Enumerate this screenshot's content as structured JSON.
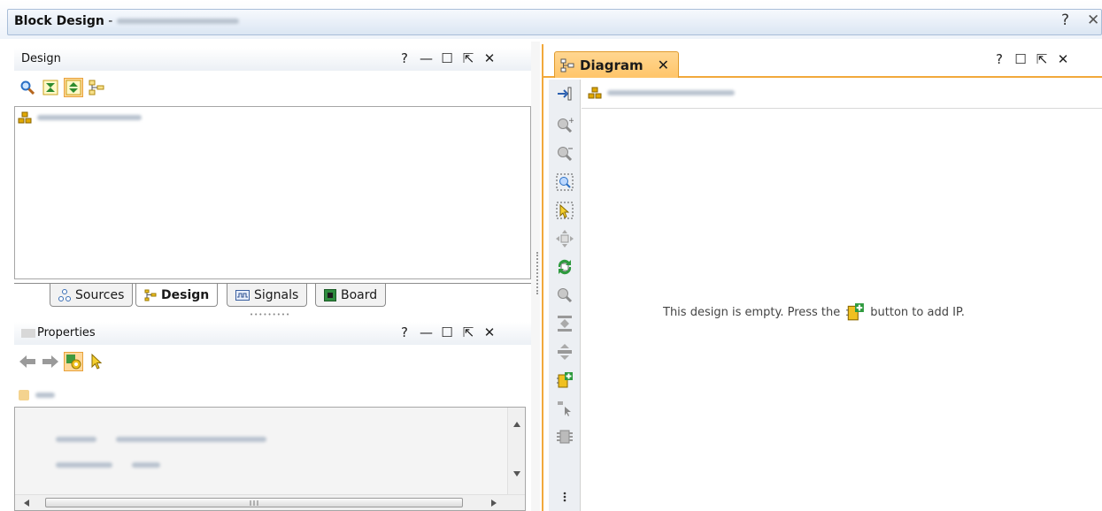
{
  "window": {
    "title": "Block Design",
    "title_separator": " - ",
    "help": "?",
    "close": "✕"
  },
  "design_pane": {
    "title": "Design",
    "buttons": {
      "help": "?",
      "minimize": "—",
      "maximize": "☐",
      "float": "⇱",
      "close": "✕"
    },
    "toolbar": [
      "search-icon",
      "collapse-all-icon",
      "expand-all-icon",
      "hierarchy-icon"
    ],
    "tree": {
      "root_icon": "block-design-icon"
    }
  },
  "tabs": [
    {
      "label": "Sources",
      "icon": "sources-icon",
      "active": false
    },
    {
      "label": "Design",
      "icon": "design-icon",
      "active": true
    },
    {
      "label": "Signals",
      "icon": "signals-icon",
      "active": false
    },
    {
      "label": "Board",
      "icon": "board-icon",
      "active": false
    }
  ],
  "properties_pane": {
    "title": "Properties",
    "buttons": {
      "help": "?",
      "minimize": "—",
      "maximize": "☐",
      "float": "⇱",
      "close": "✕"
    },
    "toolbar": [
      "back-arrow-icon",
      "forward-arrow-icon",
      "settings-icon",
      "select-icon"
    ]
  },
  "diagram_pane": {
    "tab_label": "Diagram",
    "tab_close": "✕",
    "buttons": {
      "help": "?",
      "maximize": "☐",
      "float": "⇱",
      "close": "✕"
    },
    "empty_message_before": "This design is empty. Press the",
    "empty_message_after": "button to add IP.",
    "vertical_toolbar": [
      "zoom-in-icon",
      "zoom-out-icon",
      "zoom-fit-icon",
      "select-area-icon",
      "move-icon",
      "refresh-icon",
      "search-icon",
      "align-top-icon",
      "align-center-icon",
      "add-ip-icon",
      "pointer-icon",
      "processor-icon"
    ]
  },
  "colors": {
    "accent": "#f2a93b",
    "tab_active": "#ffc56a",
    "title_bar": "#dbe6f3"
  }
}
